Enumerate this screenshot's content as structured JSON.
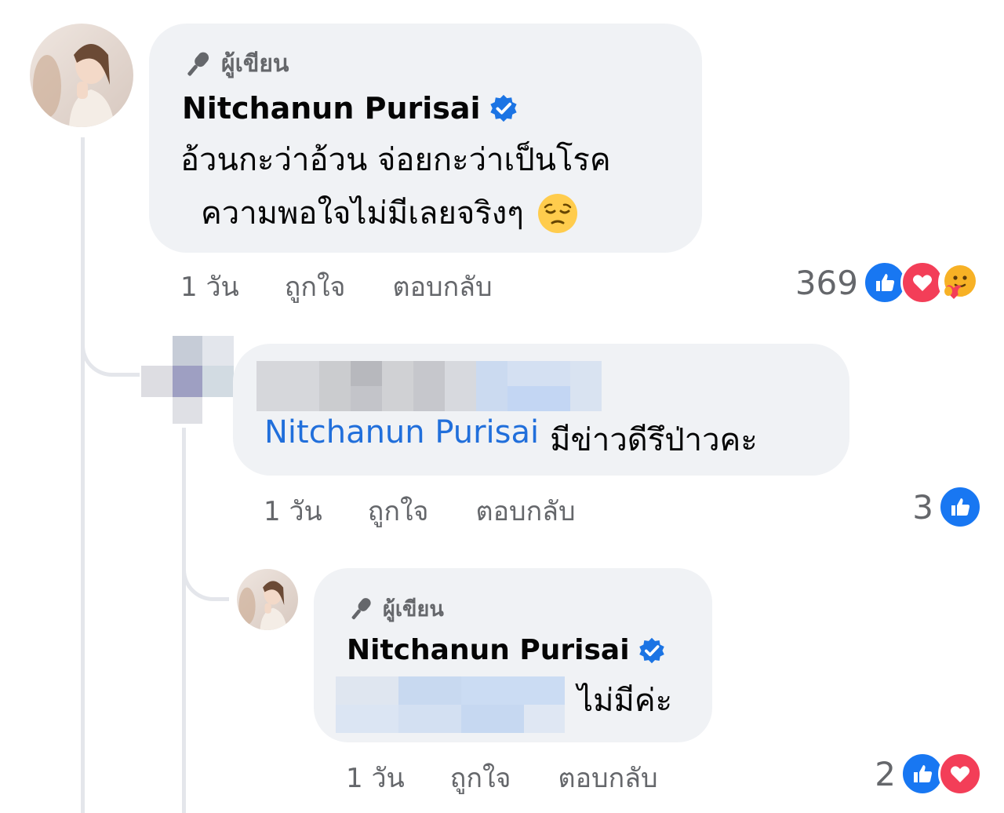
{
  "colors": {
    "bubble": "#f0f2f5",
    "mention": "#216fdb",
    "meta_text": "#65676b",
    "like_blue": "#1877f2",
    "love_red": "#f33e58",
    "verified_blue": "#1b74e4",
    "thread_line": "#e4e6eb"
  },
  "comments": [
    {
      "author_badge": "ผู้เขียน",
      "author_name": "Nitchanun Purisai",
      "verified": true,
      "text_line1": "อ้วนกะว่าอ้วน จ่อยกะว่าเป็นโรค",
      "text_line2": "ความพอใจไม่มีเลยจริงๆ",
      "emoji": "pensive-face",
      "time": "1 วัน",
      "like_action": "ถูกใจ",
      "reply_action": "ตอบกลับ",
      "reaction_count": "369",
      "reactions": [
        "like",
        "love",
        "care"
      ]
    },
    {
      "author_name_blurred": true,
      "mention": "Nitchanun Purisai",
      "text": "มีข่าวดีรึป่าวคะ",
      "time": "1 วัน",
      "like_action": "ถูกใจ",
      "reply_action": "ตอบกลับ",
      "reaction_count": "3",
      "reactions": [
        "like"
      ]
    },
    {
      "author_badge": "ผู้เขียน",
      "author_name": "Nitchanun Purisai",
      "verified": true,
      "mention_blurred": true,
      "text": "ไม่มีค่ะ",
      "time": "1 วัน",
      "like_action": "ถูกใจ",
      "reply_action": "ตอบกลับ",
      "reaction_count": "2",
      "reactions": [
        "like",
        "love"
      ]
    }
  ]
}
